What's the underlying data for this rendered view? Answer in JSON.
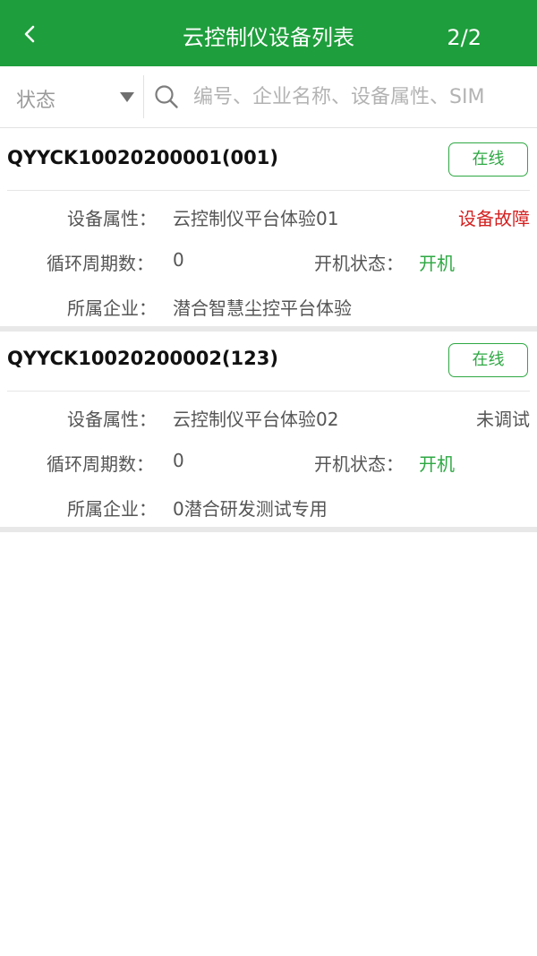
{
  "header": {
    "title": "云控制仪设备列表",
    "page_indicator": "2/2",
    "background_color": "#1e9e3c",
    "back_icon": "chevron-left-icon"
  },
  "filter": {
    "status_label": "状态",
    "status_icon": "caret-down-icon",
    "search_icon": "search-icon",
    "search_placeholder": "编号、企业名称、设备属性、SIM"
  },
  "devices": [
    {
      "id": "QYYCK10020200001(001)",
      "online_label": "在线",
      "attr_label": "设备属性：",
      "attr_value": "云控制仪平台体验01",
      "fault_status": "设备故障",
      "fault_color": "#d42121",
      "cycle_label": "循环周期数：",
      "cycle_value": "0",
      "power_label": "开机状态：",
      "power_value": "开机",
      "company_label": "所属企业：",
      "company_value": "潜合智慧尘控平台体验"
    },
    {
      "id": "QYYCK10020200002(123)",
      "online_label": "在线",
      "attr_label": "设备属性：",
      "attr_value": "云控制仪平台体验02",
      "fault_status": "未调试",
      "fault_color": "#555555",
      "cycle_label": "循环周期数：",
      "cycle_value": "0",
      "power_label": "开机状态：",
      "power_value": "开机",
      "company_label": "所属企业：",
      "company_value": "0潜合研发测试专用"
    }
  ],
  "colors": {
    "accent_green": "#2ea843",
    "fault_red": "#d42121"
  }
}
